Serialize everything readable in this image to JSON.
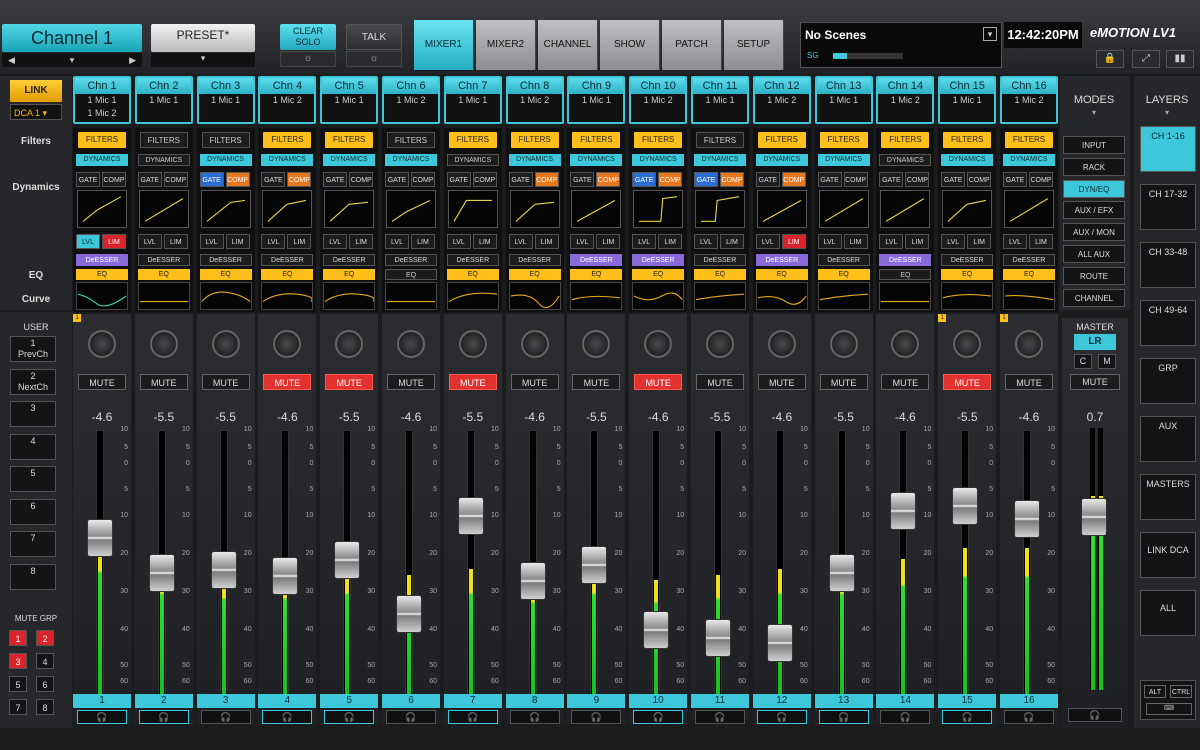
{
  "header": {
    "channel_name": "Channel 1",
    "preset": "PRESET*",
    "clear_solo": "CLEAR SOLO",
    "talk": "TALK",
    "tabs": [
      "MIXER1",
      "MIXER2",
      "CHANNEL",
      "SHOW",
      "PATCH",
      "SETUP"
    ],
    "active_tab": "MIXER1",
    "scenes": "No Scenes",
    "sg": "SG",
    "clock": "12:42:20PM",
    "logo": "eMOTION LV1"
  },
  "left": {
    "link": "LINK",
    "dca": "DCA 1",
    "filters_label": "Filters",
    "dynamics_label": "Dynamics",
    "eq_label": "EQ",
    "curve_label": "Curve",
    "user_label": "USER",
    "user_buttons": [
      {
        "n": "1",
        "t": "PrevCh"
      },
      {
        "n": "2",
        "t": "NextCh"
      },
      {
        "n": "3",
        "t": ""
      },
      {
        "n": "4",
        "t": ""
      },
      {
        "n": "5",
        "t": ""
      },
      {
        "n": "6",
        "t": ""
      },
      {
        "n": "7",
        "t": ""
      },
      {
        "n": "8",
        "t": ""
      }
    ],
    "mute_grp_label": "MUTE GRP",
    "mute_groups": [
      {
        "n": "1",
        "on": true
      },
      {
        "n": "2",
        "on": true
      },
      {
        "n": "3",
        "on": true
      },
      {
        "n": "4",
        "on": false
      },
      {
        "n": "5",
        "on": false
      },
      {
        "n": "6",
        "on": false
      },
      {
        "n": "7",
        "on": false
      },
      {
        "n": "8",
        "on": false
      }
    ]
  },
  "strip_labels": {
    "filters": "FILTERS",
    "dynamics": "DYNAMICS",
    "gate": "GATE",
    "comp": "COMP",
    "lvl": "LVL",
    "lim": "LIM",
    "deesser": "DeESSER",
    "eq": "EQ",
    "mute": "MUTE",
    "scale": [
      "10",
      "5",
      "0",
      "5",
      "10",
      "20",
      "30",
      "40",
      "50",
      "60",
      "∞"
    ]
  },
  "channels": [
    {
      "name": "Chn 1",
      "src1": "1 Mic 1",
      "src2": "1 Mic 2",
      "filters": true,
      "dyn": true,
      "gate": false,
      "comp": false,
      "lvl": true,
      "lim": true,
      "deess": true,
      "eq": true,
      "mute": false,
      "db": "-4.6",
      "fader": 0.6,
      "meter": 0.58,
      "num": "1",
      "hp": true,
      "mark": true
    },
    {
      "name": "Chn 2",
      "src1": "1 Mic 1",
      "src2": "",
      "filters": false,
      "dyn": false,
      "gate": false,
      "comp": false,
      "lvl": false,
      "lim": false,
      "deess": false,
      "eq": true,
      "mute": false,
      "db": "-5.5",
      "fader": 0.47,
      "meter": 0.48,
      "num": "2",
      "hp": true,
      "mark": false
    },
    {
      "name": "Chn 3",
      "src1": "1 Mic 1",
      "src2": "",
      "filters": false,
      "dyn": true,
      "gate": true,
      "comp": true,
      "lvl": false,
      "lim": false,
      "deess": false,
      "eq": true,
      "mute": false,
      "db": "-5.5",
      "fader": 0.48,
      "meter": 0.46,
      "num": "3",
      "hp": false,
      "mark": false
    },
    {
      "name": "Chn 4",
      "src1": "1 Mic 2",
      "src2": "",
      "filters": true,
      "dyn": true,
      "gate": false,
      "comp": true,
      "lvl": false,
      "lim": false,
      "deess": false,
      "eq": true,
      "mute": true,
      "db": "-4.6",
      "fader": 0.46,
      "meter": 0.46,
      "num": "4",
      "hp": true,
      "mark": false
    },
    {
      "name": "Chn 5",
      "src1": "1 Mic 1",
      "src2": "",
      "filters": true,
      "dyn": true,
      "gate": false,
      "comp": false,
      "lvl": false,
      "lim": false,
      "deess": false,
      "eq": true,
      "mute": true,
      "db": "-5.5",
      "fader": 0.52,
      "meter": 0.48,
      "num": "5",
      "hp": true,
      "mark": false
    },
    {
      "name": "Chn 6",
      "src1": "1 Mic 2",
      "src2": "",
      "filters": false,
      "dyn": true,
      "gate": false,
      "comp": false,
      "lvl": false,
      "lim": false,
      "deess": false,
      "eq": false,
      "mute": false,
      "db": "-4.6",
      "fader": 0.32,
      "meter": 0.46,
      "num": "6",
      "hp": false,
      "mark": false
    },
    {
      "name": "Chn 7",
      "src1": "1 Mic 1",
      "src2": "",
      "filters": true,
      "dyn": false,
      "gate": false,
      "comp": false,
      "lvl": false,
      "lim": false,
      "deess": false,
      "eq": true,
      "mute": true,
      "db": "-5.5",
      "fader": 0.68,
      "meter": 0.48,
      "num": "7",
      "hp": true,
      "mark": false
    },
    {
      "name": "Chn 8",
      "src1": "1 Mic 2",
      "src2": "",
      "filters": true,
      "dyn": true,
      "gate": false,
      "comp": true,
      "lvl": false,
      "lim": false,
      "deess": false,
      "eq": true,
      "mute": false,
      "db": "-4.6",
      "fader": 0.44,
      "meter": 0.44,
      "num": "8",
      "hp": false,
      "mark": false
    },
    {
      "name": "Chn 9",
      "src1": "1 Mic 1",
      "src2": "",
      "filters": true,
      "dyn": true,
      "gate": false,
      "comp": true,
      "lvl": false,
      "lim": false,
      "deess": true,
      "eq": true,
      "mute": false,
      "db": "-5.5",
      "fader": 0.5,
      "meter": 0.48,
      "num": "9",
      "hp": false,
      "mark": false
    },
    {
      "name": "Chn 10",
      "src1": "1 Mic 2",
      "src2": "",
      "filters": true,
      "dyn": true,
      "gate": true,
      "comp": true,
      "lvl": false,
      "lim": false,
      "deess": true,
      "eq": true,
      "mute": true,
      "db": "-4.6",
      "fader": 0.26,
      "meter": 0.44,
      "num": "10",
      "hp": true,
      "mark": false
    },
    {
      "name": "Chn 11",
      "src1": "1 Mic 1",
      "src2": "",
      "filters": false,
      "dyn": true,
      "gate": true,
      "comp": true,
      "lvl": false,
      "lim": false,
      "deess": false,
      "eq": true,
      "mute": false,
      "db": "-5.5",
      "fader": 0.23,
      "meter": 0.46,
      "num": "11",
      "hp": false,
      "mark": false
    },
    {
      "name": "Chn 12",
      "src1": "1 Mic 2",
      "src2": "",
      "filters": true,
      "dyn": true,
      "gate": false,
      "comp": true,
      "lvl": false,
      "lim": true,
      "deess": true,
      "eq": true,
      "mute": false,
      "db": "-4.6",
      "fader": 0.21,
      "meter": 0.48,
      "num": "12",
      "hp": true,
      "mark": false
    },
    {
      "name": "Chn 13",
      "src1": "1 Mic 1",
      "src2": "",
      "filters": true,
      "dyn": true,
      "gate": false,
      "comp": false,
      "lvl": false,
      "lim": false,
      "deess": false,
      "eq": true,
      "mute": false,
      "db": "-5.5",
      "fader": 0.47,
      "meter": 0.48,
      "num": "13",
      "hp": true,
      "mark": false
    },
    {
      "name": "Chn 14",
      "src1": "1 Mic 2",
      "src2": "",
      "filters": true,
      "dyn": false,
      "gate": false,
      "comp": false,
      "lvl": false,
      "lim": false,
      "deess": true,
      "eq": false,
      "mute": false,
      "db": "-4.6",
      "fader": 0.7,
      "meter": 0.52,
      "num": "14",
      "hp": false,
      "mark": false
    },
    {
      "name": "Chn 15",
      "src1": "1 Mic 1",
      "src2": "",
      "filters": true,
      "dyn": true,
      "gate": false,
      "comp": false,
      "lvl": false,
      "lim": false,
      "deess": false,
      "eq": true,
      "mute": true,
      "db": "-5.5",
      "fader": 0.72,
      "meter": 0.56,
      "num": "15",
      "hp": true,
      "mark": true
    },
    {
      "name": "Chn 16",
      "src1": "1 Mic 2",
      "src2": "",
      "filters": true,
      "dyn": true,
      "gate": false,
      "comp": false,
      "lvl": false,
      "lim": false,
      "deess": false,
      "eq": true,
      "mute": false,
      "db": "-4.6",
      "fader": 0.67,
      "meter": 0.56,
      "num": "16",
      "hp": false,
      "mark": true
    }
  ],
  "modes": {
    "title": "MODES",
    "items": [
      {
        "label": "INPUT",
        "on": false
      },
      {
        "label": "RACK",
        "on": false
      },
      {
        "label": "DYN/EQ",
        "on": true
      },
      {
        "label": "AUX / EFX",
        "on": false
      },
      {
        "label": "AUX / MON",
        "on": false
      },
      {
        "label": "ALL AUX",
        "on": false
      },
      {
        "label": "ROUTE",
        "on": false
      },
      {
        "label": "CHANNEL",
        "on": false
      }
    ]
  },
  "master": {
    "title": "MASTER",
    "lr": "LR",
    "c": "C",
    "m": "M",
    "mute": "MUTE",
    "db": "0.7",
    "fader": 0.66,
    "meter": 0.74
  },
  "layers": {
    "title": "LAYERS",
    "items": [
      {
        "label": "CH 1-16",
        "on": true
      },
      {
        "label": "CH 17-32",
        "on": false
      },
      {
        "label": "CH 33-48",
        "on": false
      },
      {
        "label": "CH 49-64",
        "on": false
      },
      {
        "label": "GRP",
        "on": false
      },
      {
        "label": "AUX",
        "on": false
      },
      {
        "label": "MASTERS",
        "on": false
      },
      {
        "label": "LINK DCA",
        "on": false
      },
      {
        "label": "ALL",
        "on": false
      }
    ],
    "alt": "ALT",
    "ctrl": "CTRL"
  },
  "colors": {
    "accent": "#3cc8da",
    "yellow": "#ffbf1a",
    "red": "#e2322f",
    "gate": "#2a6cd6",
    "comp": "#e8761a",
    "deess": "#8a6ad8"
  }
}
